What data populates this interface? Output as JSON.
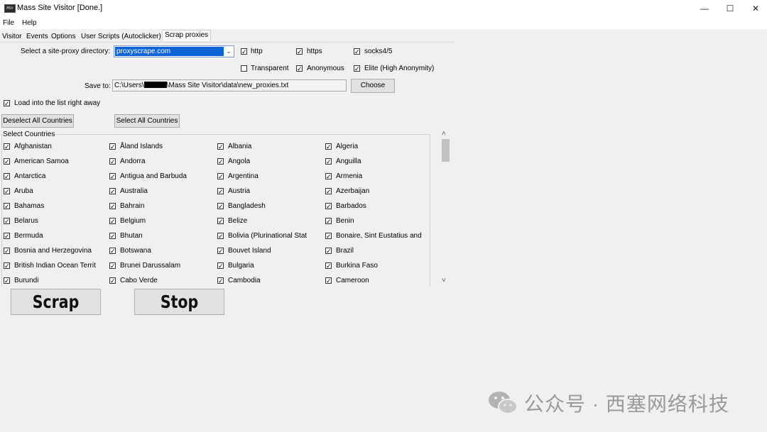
{
  "window": {
    "title": "Mass Site Visitor [Done.]",
    "icon_text": "MSV",
    "minimize_icon": "—",
    "maximize_icon": "☐",
    "close_icon": "✕"
  },
  "menu": [
    "File",
    "Help"
  ],
  "tabs": [
    "Visitor",
    "Events",
    "Options",
    "User Scripts (Autoclicker)",
    "Scrap proxies"
  ],
  "active_tab": "Scrap proxies",
  "proxy_directory": {
    "label": "Select a site-proxy directory:",
    "value": "proxyscrape.com"
  },
  "protocols": [
    {
      "label": "http",
      "checked": true
    },
    {
      "label": "https",
      "checked": true
    },
    {
      "label": "socks4/5",
      "checked": true
    }
  ],
  "anonymity": [
    {
      "label": "Transparent",
      "checked": false
    },
    {
      "label": "Anonymous",
      "checked": true
    },
    {
      "label": "Elite (High Anonymity)",
      "checked": true
    }
  ],
  "save": {
    "label": "Save to:",
    "path_prefix": "C:\\Users\\",
    "path_suffix": "\\Mass Site Visitor\\data\\new_proxies.txt",
    "choose_label": "Choose"
  },
  "load_into_list": {
    "label": "Load into the list right away",
    "checked": true
  },
  "deselect_all_label": "Deselect All Countries",
  "select_all_label": "Select All Countries",
  "countries_group_title": "Select Countries",
  "countries": [
    [
      "Afghanistan",
      "Åland Islands",
      "Albania",
      "Algeria"
    ],
    [
      "American Samoa",
      "Andorra",
      "Angola",
      "Anguilla"
    ],
    [
      "Antarctica",
      "Antigua and Barbuda",
      "Argentina",
      "Armenia"
    ],
    [
      "Aruba",
      "Australia",
      "Austria",
      "Azerbaijan"
    ],
    [
      "Bahamas",
      "Bahrain",
      "Bangladesh",
      "Barbados"
    ],
    [
      "Belarus",
      "Belgium",
      "Belize",
      "Benin"
    ],
    [
      "Bermuda",
      "Bhutan",
      "Bolivia (Plurinational Stat",
      "Bonaire, Sint Eustatius and"
    ],
    [
      "Bosnia and Herzegovina",
      "Botswana",
      "Bouvet Island",
      "Brazil"
    ],
    [
      "British Indian Ocean Territ",
      "Brunei Darussalam",
      "Bulgaria",
      "Burkina Faso"
    ],
    [
      "Burundi",
      "Cabo Verde",
      "Cambodia",
      "Cameroon"
    ]
  ],
  "scroll": {
    "up_icon": "˄",
    "down_icon": "˅"
  },
  "scrap_label": "Scrap",
  "stop_label": "Stop",
  "watermark": {
    "text": "公众号 · 西塞网络科技"
  },
  "check_mark": "✓"
}
